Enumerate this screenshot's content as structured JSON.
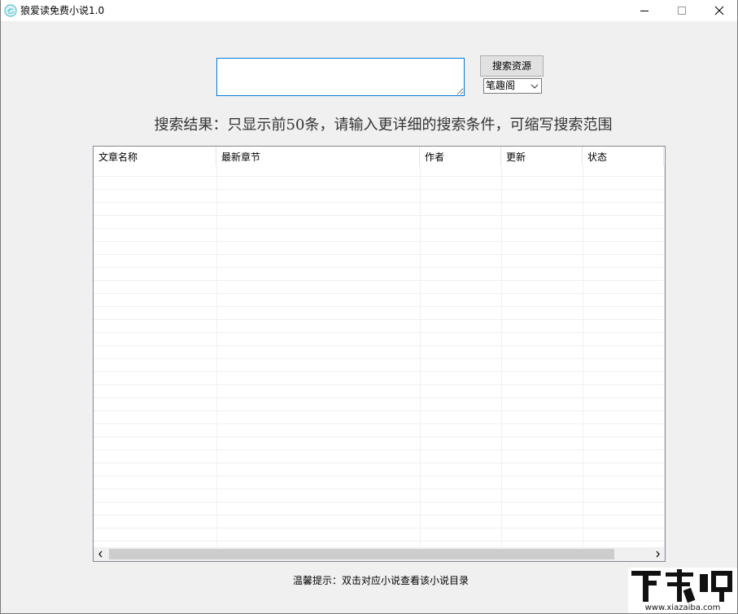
{
  "window": {
    "title": "狼爱读免费小说1.0",
    "icon": "app-swirl-icon",
    "controls": {
      "minimize_icon": "minimize-icon",
      "maximize_icon": "maximize-icon",
      "close_icon": "close-icon"
    }
  },
  "search": {
    "input_value": "",
    "placeholder": "",
    "button_label": "搜索资源",
    "source_selected": "笔趣阁"
  },
  "result_info": "搜索结果：只显示前50条，请输入更详细的搜索条件，可缩写搜索范围",
  "table": {
    "columns": [
      "文章名称",
      "最新章节",
      "作者",
      "更新",
      "状态"
    ],
    "rows": []
  },
  "hint": "温馨提示：双击对应小说查看该小说目录",
  "watermark": {
    "logo_text": "下载吧",
    "url_text": "www.xiazaiba.com"
  },
  "colors": {
    "background": "#f0f0f0",
    "input_focus_border": "#0078d7",
    "button_face": "#e1e1e1"
  }
}
